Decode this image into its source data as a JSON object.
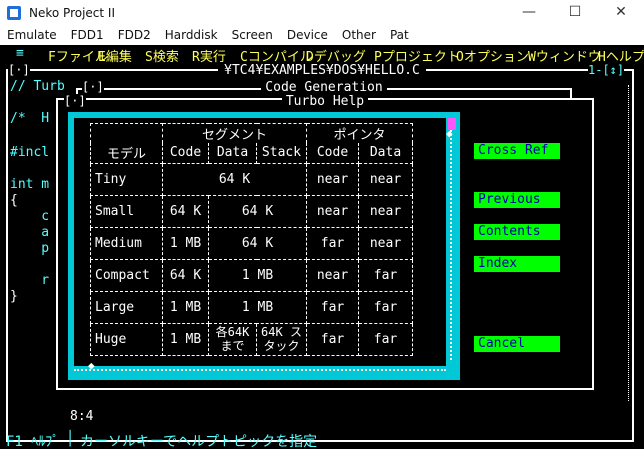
{
  "window": {
    "title": "Neko Project II",
    "minimize": "—",
    "maximize": "☐",
    "close": "✕"
  },
  "menubar": [
    "Emulate",
    "FDD1",
    "FDD2",
    "Harddisk",
    "Screen",
    "Device",
    "Other",
    "Pat"
  ],
  "tc_menu": {
    "system": "≡",
    "items": [
      "Fファイル",
      "E編集",
      "S検索",
      "R実行",
      "Cコンパイル",
      "Dデバッグ",
      "Pプロジェクト",
      "Oオプション",
      "Wウィンドウ",
      "Hヘルプ"
    ]
  },
  "editor": {
    "title": "¥TC4¥EXAMPLES¥DOS¥HELLO.C",
    "close_box": "[·]",
    "window_no": "1-[↕]",
    "lines": [
      "// Turb",
      "/*  H",
      "#incl",
      "int m",
      "{",
      "    c",
      "    a",
      "    p",
      "    r",
      "}"
    ],
    "position": "8:4"
  },
  "code_gen_dialog": {
    "title": "Code Generation",
    "close_box": "[·]"
  },
  "help_dialog": {
    "title": "Turbo Help",
    "close_box": "[·]",
    "table": {
      "header1": [
        "",
        "セグメント",
        "ポインタ"
      ],
      "header2": [
        "モデル",
        "Code",
        "Data",
        "Stack",
        "Code",
        "Data"
      ],
      "rows": [
        [
          "Tiny",
          "64 K",
          "near",
          "near"
        ],
        [
          "Small",
          "64 K",
          "64 K",
          "near",
          "near"
        ],
        [
          "Medium",
          "1 MB",
          "64 K",
          "far",
          "near"
        ],
        [
          "Compact",
          "64 K",
          "1 MB",
          "near",
          "far"
        ],
        [
          "Large",
          "1 MB",
          "1 MB",
          "far",
          "far"
        ],
        [
          "Huge",
          "1 MB",
          "各64K まで",
          "64K スタック",
          "far",
          "far"
        ]
      ]
    },
    "buttons": {
      "cross_ref": "Cross Ref",
      "previous": "Previous",
      "contents": "Contents",
      "index": "Index",
      "cancel": "Cancel"
    }
  },
  "status_bar": {
    "f1": "F1 ﾍﾙﾌﾟ",
    "separator": "│",
    "hint": "カーソルキーでヘルプトピックを指定"
  },
  "colors": {
    "screen_bg": "#000000",
    "menu_text": "#ffff55",
    "cyan": "#00c8d7",
    "button_bg": "#00ff00",
    "button_text": "#0000aa",
    "hotkey": "#ffff00",
    "scroll_thumb": "#ff55ff"
  }
}
